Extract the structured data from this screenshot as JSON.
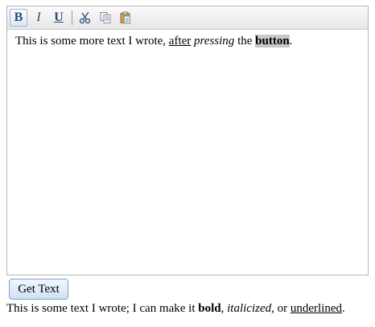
{
  "toolbar": {
    "bold_label": "B",
    "italic_label": "I",
    "underline_label": "U",
    "cut_icon": "cut-icon",
    "copy_icon": "copy-icon",
    "paste_icon": "paste-icon"
  },
  "editor": {
    "t1": "This is some more text I wrote, ",
    "t2": "after",
    "t3": " ",
    "t4": "pressing",
    "t5": " the ",
    "t6": "button",
    "t7": "."
  },
  "get_text_label": "Get Text",
  "output": {
    "o1": "This is some text I wrote; I can make it ",
    "o2": "bold",
    "o3": ", ",
    "o4": "italicized",
    "o5": ", or ",
    "o6": "underlined",
    "o7": "."
  },
  "colors": {
    "toolbar_icon": "#2a4a7a",
    "selection_highlight": "#c8c8c8",
    "button_border": "#7ea1cc"
  }
}
